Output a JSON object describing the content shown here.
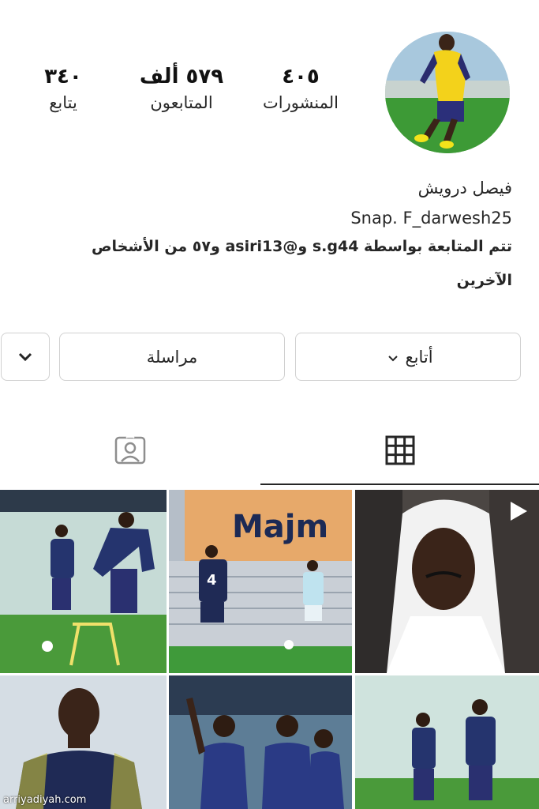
{
  "profile": {
    "name": "فيصل درويش",
    "snap": "Snap. F_darwesh25",
    "followed_by_line1": "تتم المتابعة بواسطة s.g44 و@asiri13 و٥٧ من الأشخاص",
    "followed_by_line2": "الآخرين",
    "avatar_icon": "profile-photo"
  },
  "stats": {
    "posts": {
      "value": "٤٠٥",
      "label": "المنشورات"
    },
    "followers": {
      "value": "٥٧٩ ألف",
      "label": "المتابعون"
    },
    "following": {
      "value": "٣٤٠",
      "label": "يتابع"
    }
  },
  "buttons": {
    "follow": "أتابع",
    "message": "مراسلة"
  },
  "tabs": {
    "grid_icon": "grid-icon",
    "tagged_icon": "tagged-icon"
  },
  "grid": {
    "banner_text": "Majm"
  },
  "watermark": "arriyadiyah.com",
  "colors": {
    "border": "#d0d0d0",
    "tab_indicator": "#262626"
  }
}
